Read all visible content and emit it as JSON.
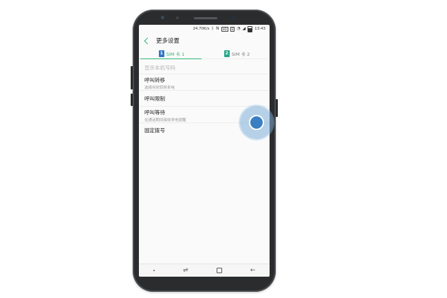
{
  "status_bar": {
    "speed": "24.70K/s",
    "box_label": "HD",
    "sim_label": "S",
    "time": "13:43"
  },
  "header": {
    "title": "更多设置"
  },
  "tabs": [
    {
      "sim_number": "1",
      "label": "SIM 卡 1",
      "active": true
    },
    {
      "sim_number": "2",
      "label": "SIM 卡 2",
      "active": false
    }
  ],
  "settings": [
    {
      "title": "显示本机号码",
      "subtitle": "",
      "enabled": false
    },
    {
      "title": "呼叫转移",
      "subtitle": "选择何时转移来电",
      "enabled": true
    },
    {
      "title": "呼叫限制",
      "subtitle": "",
      "enabled": true
    },
    {
      "title": "呼叫等待",
      "subtitle": "在通话期间接收来电提醒",
      "enabled": true
    },
    {
      "title": "固定拨号",
      "subtitle": "",
      "enabled": true
    }
  ],
  "colors": {
    "accent": "#2ab573",
    "sim1": "#2f76c9",
    "sim2": "#2aa58a",
    "touch_indicator": "#3a7fc4"
  }
}
